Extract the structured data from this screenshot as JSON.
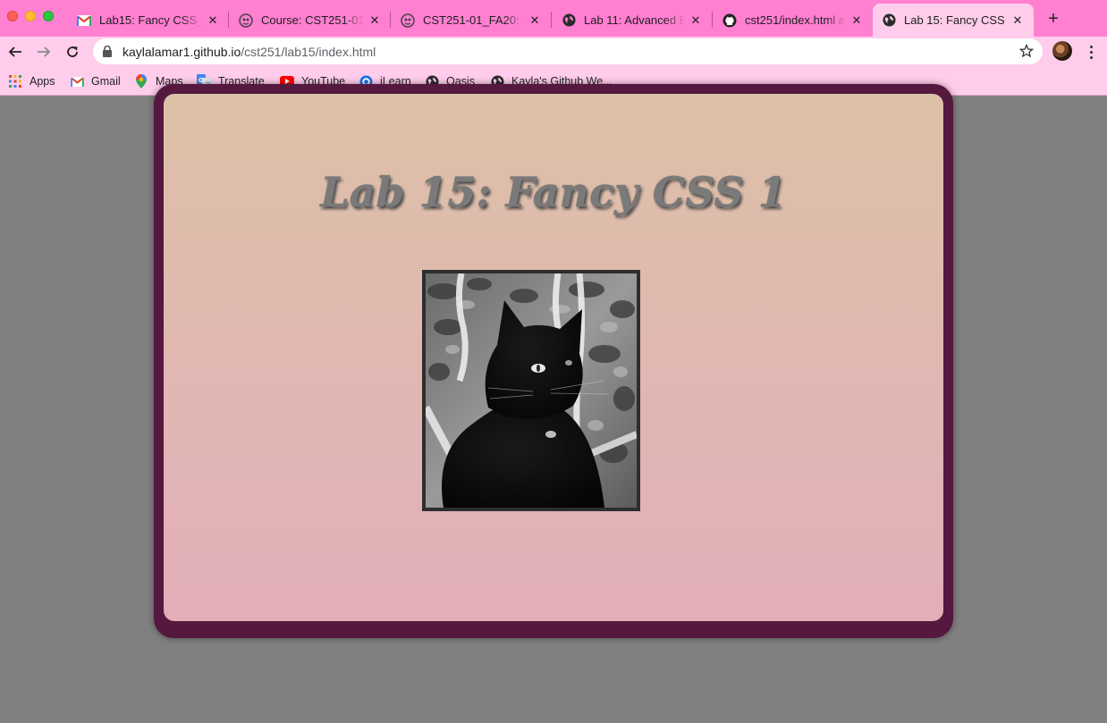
{
  "browser": {
    "tabs": [
      {
        "title": "Lab15: Fancy CSS_N",
        "icon": "gmail-icon",
        "active": false
      },
      {
        "title": "Course: CST251-01_",
        "icon": "moodle-icon",
        "active": false
      },
      {
        "title": "CST251-01_FA20: La",
        "icon": "moodle-icon",
        "active": false
      },
      {
        "title": "Lab 11: Advanced Blo",
        "icon": "globe-icon",
        "active": false
      },
      {
        "title": "cst251/index.html at",
        "icon": "github-icon",
        "active": false
      },
      {
        "title": "Lab 15: Fancy CSS 1",
        "icon": "globe-icon",
        "active": true
      }
    ],
    "close_glyph": "✕",
    "new_tab_glyph": "+",
    "url": {
      "host": "kaylalamar1.github.io",
      "path": "/cst251/lab15/index.html"
    },
    "bookmarks": [
      {
        "label": "Apps",
        "icon": "apps-grid-icon"
      },
      {
        "label": "Gmail",
        "icon": "gmail-icon"
      },
      {
        "label": "Maps",
        "icon": "maps-pin-icon"
      },
      {
        "label": "Translate",
        "icon": "translate-icon"
      },
      {
        "label": "YouTube",
        "icon": "youtube-icon"
      },
      {
        "label": "iLearn",
        "icon": "ilearn-icon"
      },
      {
        "label": "Oasis",
        "icon": "globe-icon"
      },
      {
        "label": "Kayla's Github We...",
        "icon": "globe-icon"
      }
    ],
    "colors": {
      "tabstrip": "#ff7fd1",
      "toolbar": "#ffcdeb"
    }
  },
  "page": {
    "heading": "Lab 15: Fancy CSS 1",
    "photo_subject": "black-cat-photo",
    "colors": {
      "background": "#808080",
      "card_border": "#55183f",
      "card_top": "#ddc1a7",
      "card_bottom": "#e3aeb8",
      "heading_text": "#7a7a7a"
    }
  }
}
